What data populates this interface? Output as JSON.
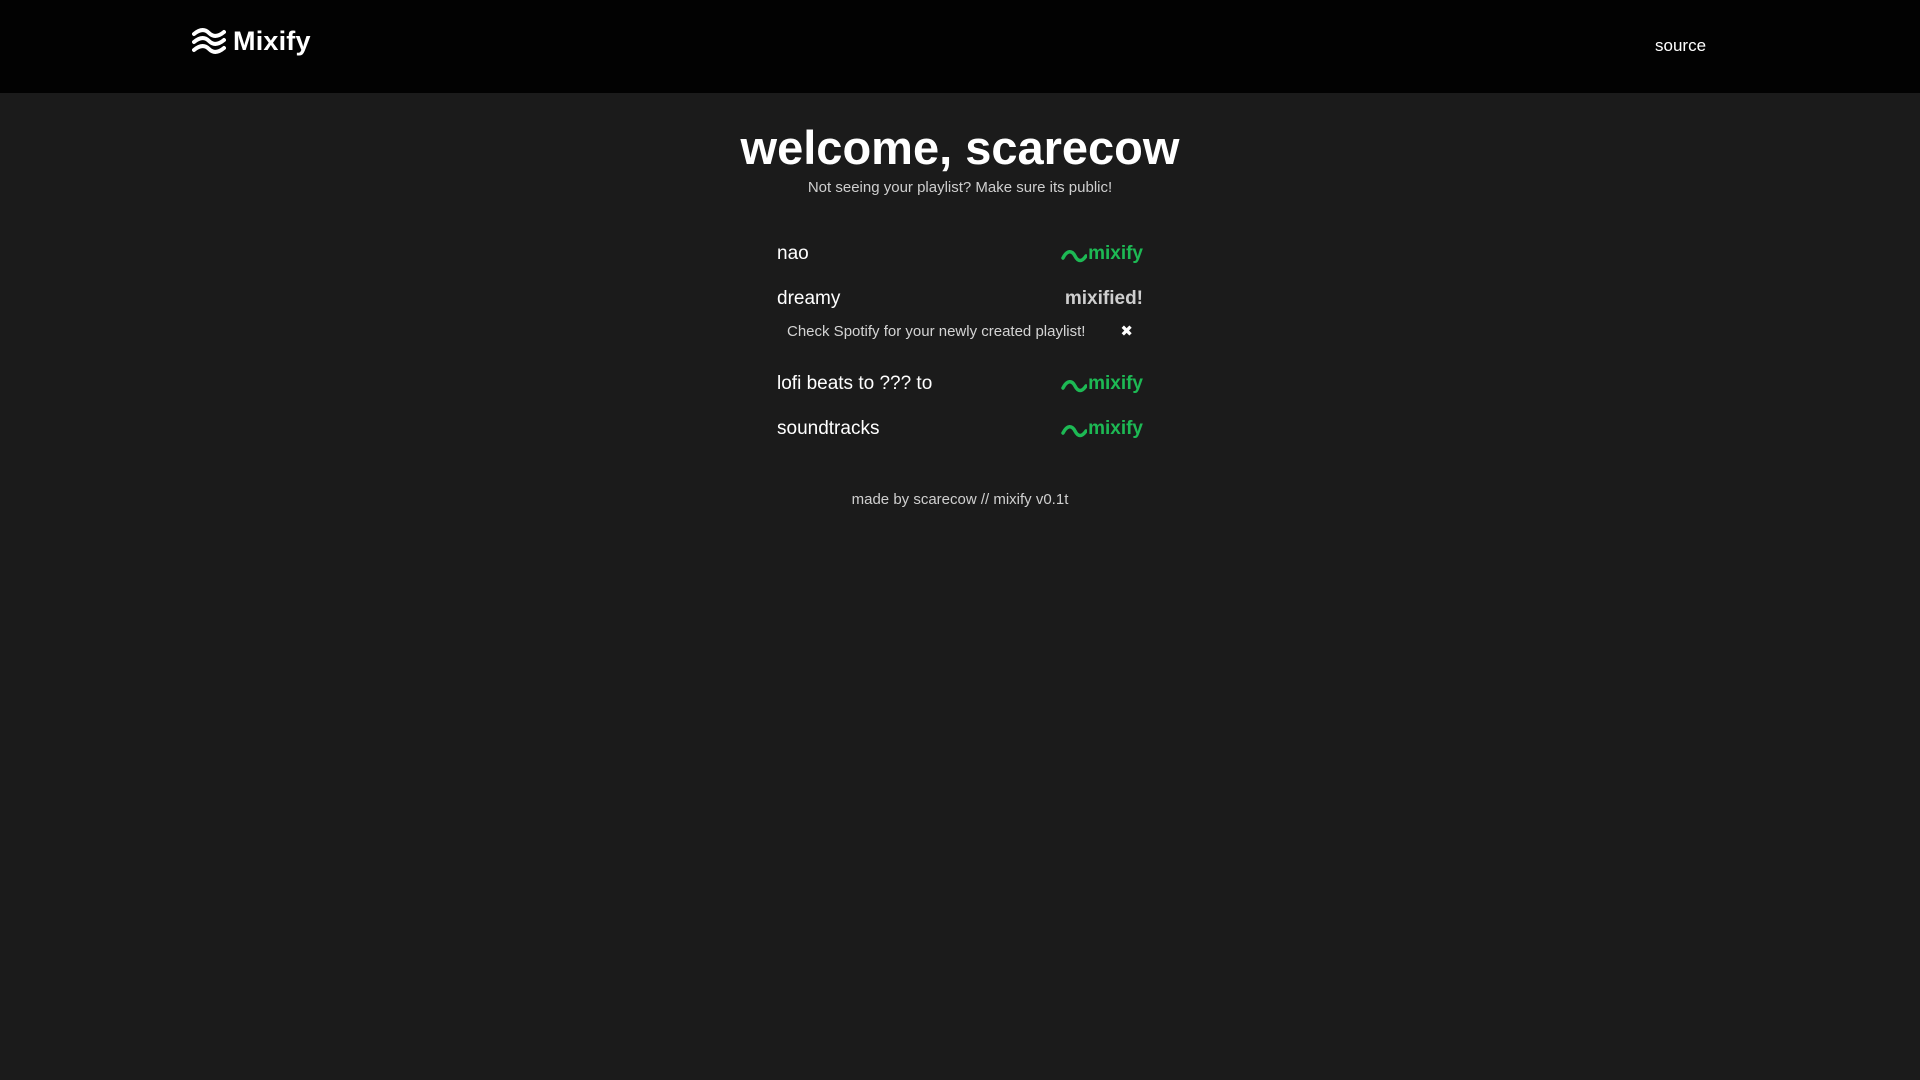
{
  "header": {
    "brand_name": "Mixify",
    "brand_icon": "waves-icon",
    "source_label": "source"
  },
  "main": {
    "welcome": "welcome, scarecow",
    "hint": "Not seeing your playlist? Make sure its public!",
    "playlists": [
      {
        "name": "nao",
        "action": "mixify"
      },
      {
        "name": "dreamy",
        "status": "mixified!"
      },
      {
        "name": "lofi beats to ??? to",
        "action": "mixify"
      },
      {
        "name": "soundtracks",
        "action": "mixify"
      }
    ],
    "notice": {
      "text": "Check Spotify for your newly created playlist!",
      "close_symbol": "✖"
    }
  },
  "footer": {
    "text": "made by scarecow // mixify v0.1t"
  },
  "colors": {
    "accent": "#1db954",
    "background": "#1b1b1b",
    "header_background": "#020202"
  }
}
